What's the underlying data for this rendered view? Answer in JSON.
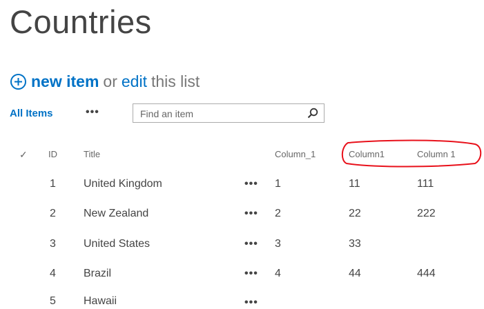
{
  "page": {
    "title": "Countries"
  },
  "actions": {
    "new_item": "new item",
    "or_text": "or",
    "edit": "edit",
    "this_list": "this list"
  },
  "view": {
    "selector": "All Items",
    "ellipsis": "•••"
  },
  "search": {
    "placeholder": "Find an item"
  },
  "icons": {
    "add": "plus-circle-icon",
    "search": "magnifier-icon",
    "select_all": "checkmark-icon"
  },
  "colors": {
    "link": "#0072c6",
    "annotation": "#e8101a",
    "text": "#444444"
  },
  "table": {
    "columns": {
      "check": "✓",
      "id": "ID",
      "title": "Title",
      "column_underscore": "Column_1",
      "column1": "Column1",
      "column_space": "Column 1"
    },
    "rows": [
      {
        "id": "1",
        "title": "United Kingdom",
        "ellipsis": "•••",
        "col_a": "1",
        "col_b": "11",
        "col_c": "111"
      },
      {
        "id": "2",
        "title": "New Zealand",
        "ellipsis": "•••",
        "col_a": "2",
        "col_b": "22",
        "col_c": "222"
      },
      {
        "id": "3",
        "title": "United States",
        "ellipsis": "•••",
        "col_a": "3",
        "col_b": "33",
        "col_c": ""
      },
      {
        "id": "4",
        "title": "Brazil",
        "ellipsis": "•••",
        "col_a": "4",
        "col_b": "44",
        "col_c": "444"
      },
      {
        "id": "5",
        "title": "Hawaii",
        "ellipsis": "•••",
        "col_a": "",
        "col_b": "",
        "col_c": ""
      }
    ]
  }
}
